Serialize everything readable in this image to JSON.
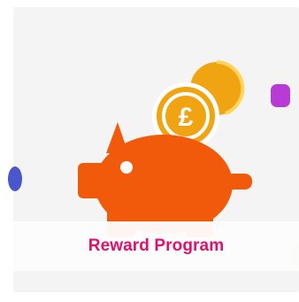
{
  "tile": {
    "label": "Reward Program",
    "icon": "piggy-bank-icon",
    "coin_symbol": "£"
  },
  "colors": {
    "label_text": "#e0106e",
    "piggy": "#f05a0a",
    "coin": "#f0a412",
    "coin_highlight": "#ffd45a",
    "purple_dot": "#b73bd4",
    "blue_dot": "#4a56cc",
    "green_dot": "#d3f1c6",
    "card_bg": "#f4f4f4"
  }
}
